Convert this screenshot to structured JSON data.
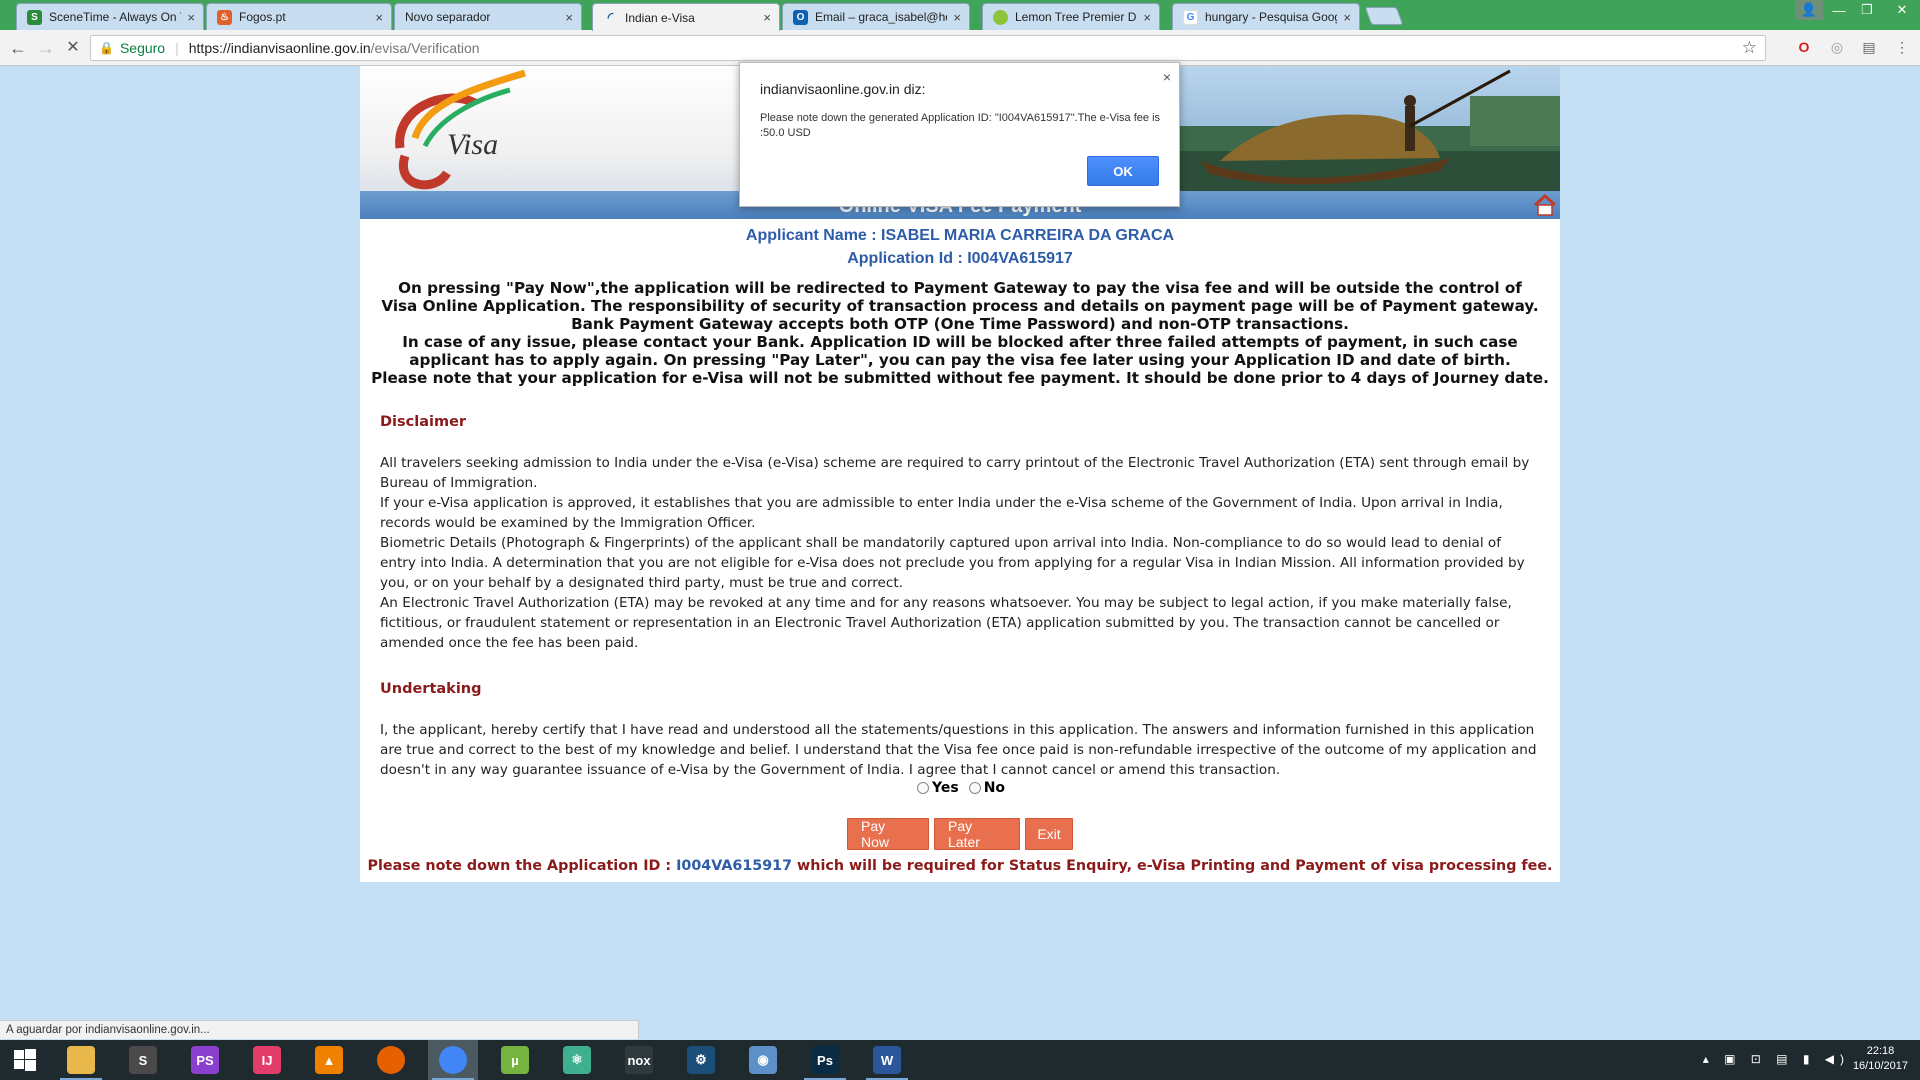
{
  "browser": {
    "tabs": [
      {
        "title": "SceneTime - Always On T",
        "icon": "scenetime-icon",
        "color": "#2a8c3a",
        "active": false
      },
      {
        "title": "Fogos.pt",
        "icon": "fire-icon",
        "color": "#e0602a",
        "active": false
      },
      {
        "title": "Novo separador",
        "icon": "",
        "color": "",
        "active": false
      },
      {
        "title": "Indian e-Visa",
        "icon": "loading-spinner-icon",
        "color": "#2e5ca8",
        "active": true
      },
      {
        "title": "Email – graca_isabel@ho",
        "icon": "outlook-icon",
        "color": "#0f62b3",
        "active": false
      },
      {
        "title": "Lemon Tree Premier Dell",
        "icon": "lemon-icon",
        "color": "#8cc43a",
        "active": false
      },
      {
        "title": "hungary - Pesquisa Goog",
        "icon": "google-icon",
        "color": "#4285f4",
        "active": false
      }
    ],
    "tab_close": "×",
    "window_controls": {
      "user": "👤",
      "minimize": "—",
      "maximize": "❐",
      "close": "✕"
    },
    "secure_label": "Seguro",
    "url_host": "https://indianvisaonline.gov.in",
    "url_path": "/evisa/Verification",
    "status_text": "A aguardar por indianvisaonline.gov.in..."
  },
  "page": {
    "header_title": "Online VISA Fee Payment",
    "applicant_name_line": "Applicant Name : ISABEL MARIA CARREIRA DA GRACA",
    "application_id_line": "Application Id : I004VA615917",
    "notice_lines": [
      "On pressing \"Pay Now\",the application will be redirected to Payment Gateway to pay the visa fee and will be outside the control of Visa Online Application. The responsibility of security of transaction process and details on payment page will be of Payment gateway. Bank Payment Gateway accepts both OTP (One Time Password) and non-OTP transactions.",
      "In case of any issue, please contact your Bank. Application ID will be blocked after three failed attempts of payment, in such case applicant has to apply again. On pressing \"Pay Later\", you can pay the visa fee later using your Application ID and date of birth.",
      "Please note that your application for e-Visa will not be submitted without fee payment. It should be done prior to 4 days of Journey date."
    ],
    "disclaimer_heading": "Disclaimer",
    "disclaimer_paragraphs": [
      "All travelers seeking admission to India under the e-Visa (e-Visa) scheme are required to carry printout of the Electronic Travel Authorization (ETA) sent through email by Bureau of Immigration.",
      "If your e-Visa application is approved, it establishes that you are admissible to enter India under the e-Visa scheme of the Government of India. Upon arrival in India, records would be examined by the Immigration Officer.",
      "Biometric Details (Photograph & Fingerprints) of the applicant shall be mandatorily captured upon arrival into India. Non-compliance to do so would lead to denial of entry into India. A determination that you are not eligible for e-Visa does not preclude you from applying for a regular Visa in Indian Mission. All information provided by you, or on your behalf by a designated third party, must be true and correct.",
      "An Electronic Travel Authorization (ETA) may be revoked at any time and for any reasons whatsoever. You may be subject to legal action, if you make materially false, fictitious, or fraudulent statement or representation in an Electronic Travel Authorization (ETA) application submitted by you. The transaction cannot be cancelled or amended once the fee has been paid."
    ],
    "undertaking_heading": "Undertaking",
    "undertaking_text": "I, the applicant, hereby certify that I have read and understood all the statements/questions in this application. The answers and information furnished in this application are true and correct to the best of my knowledge and belief. I understand that the Visa fee once paid is non-refundable irrespective of the outcome of my application and doesn't in any way guarantee issuance of e-Visa by the Government of India. I agree that I cannot cancel or amend this transaction.",
    "radio_yes": "Yes",
    "radio_no": "No",
    "pay_now": "Pay Now",
    "pay_later": "Pay Later",
    "exit": "Exit",
    "final_note_prefix": "Please note down the Application ID : ",
    "final_note_id": "I004VA615917",
    "final_note_suffix": " which will be required for Status Enquiry, e-Visa Printing and Payment of visa processing fee.",
    "logo_text": "e Visa"
  },
  "alert": {
    "title": "indianvisaonline.gov.in diz:",
    "close": "×",
    "message": "Please note down the generated Application ID: \"I004VA615917\".The e-Visa fee is :50.0 USD",
    "ok": "OK"
  },
  "taskbar": {
    "apps": [
      {
        "name": "file-explorer-icon",
        "label": "",
        "color": "#e8b94a",
        "running": true,
        "active": false
      },
      {
        "name": "sublime-text-icon",
        "label": "S",
        "color": "#4a4a4a",
        "running": false,
        "active": false
      },
      {
        "name": "phpstorm-icon",
        "label": "PS",
        "color": "#8b3fcf",
        "running": false,
        "active": false
      },
      {
        "name": "intellij-icon",
        "label": "IJ",
        "color": "#e23d6a",
        "running": false,
        "active": false
      },
      {
        "name": "vlc-icon",
        "label": "▲",
        "color": "#f08000",
        "running": false,
        "active": false
      },
      {
        "name": "firefox-icon",
        "label": "",
        "color": "#e66000",
        "running": false,
        "active": false
      },
      {
        "name": "chrome-icon",
        "label": "",
        "color": "#4285f4",
        "running": true,
        "active": true
      },
      {
        "name": "utorrent-icon",
        "label": "µ",
        "color": "#77b43f",
        "running": false,
        "active": false
      },
      {
        "name": "atom-icon",
        "label": "⚛",
        "color": "#3fb08f",
        "running": false,
        "active": false
      },
      {
        "name": "nox-icon",
        "label": "nox",
        "color": "#2f3a3e",
        "running": false,
        "active": false
      },
      {
        "name": "steam-icon",
        "label": "⚙",
        "color": "#1b4f7a",
        "running": false,
        "active": false
      },
      {
        "name": "app-icon",
        "label": "◉",
        "color": "#5d8fc9",
        "running": false,
        "active": false
      },
      {
        "name": "photoshop-icon",
        "label": "Ps",
        "color": "#0b2a44",
        "running": true,
        "active": false
      },
      {
        "name": "word-icon",
        "label": "W",
        "color": "#2b579a",
        "running": true,
        "active": false
      }
    ],
    "tray_icons": "▴ ▣ ⊡ ▤ ▮ ◀)",
    "time": "22:18",
    "date": "16/10/2017"
  }
}
